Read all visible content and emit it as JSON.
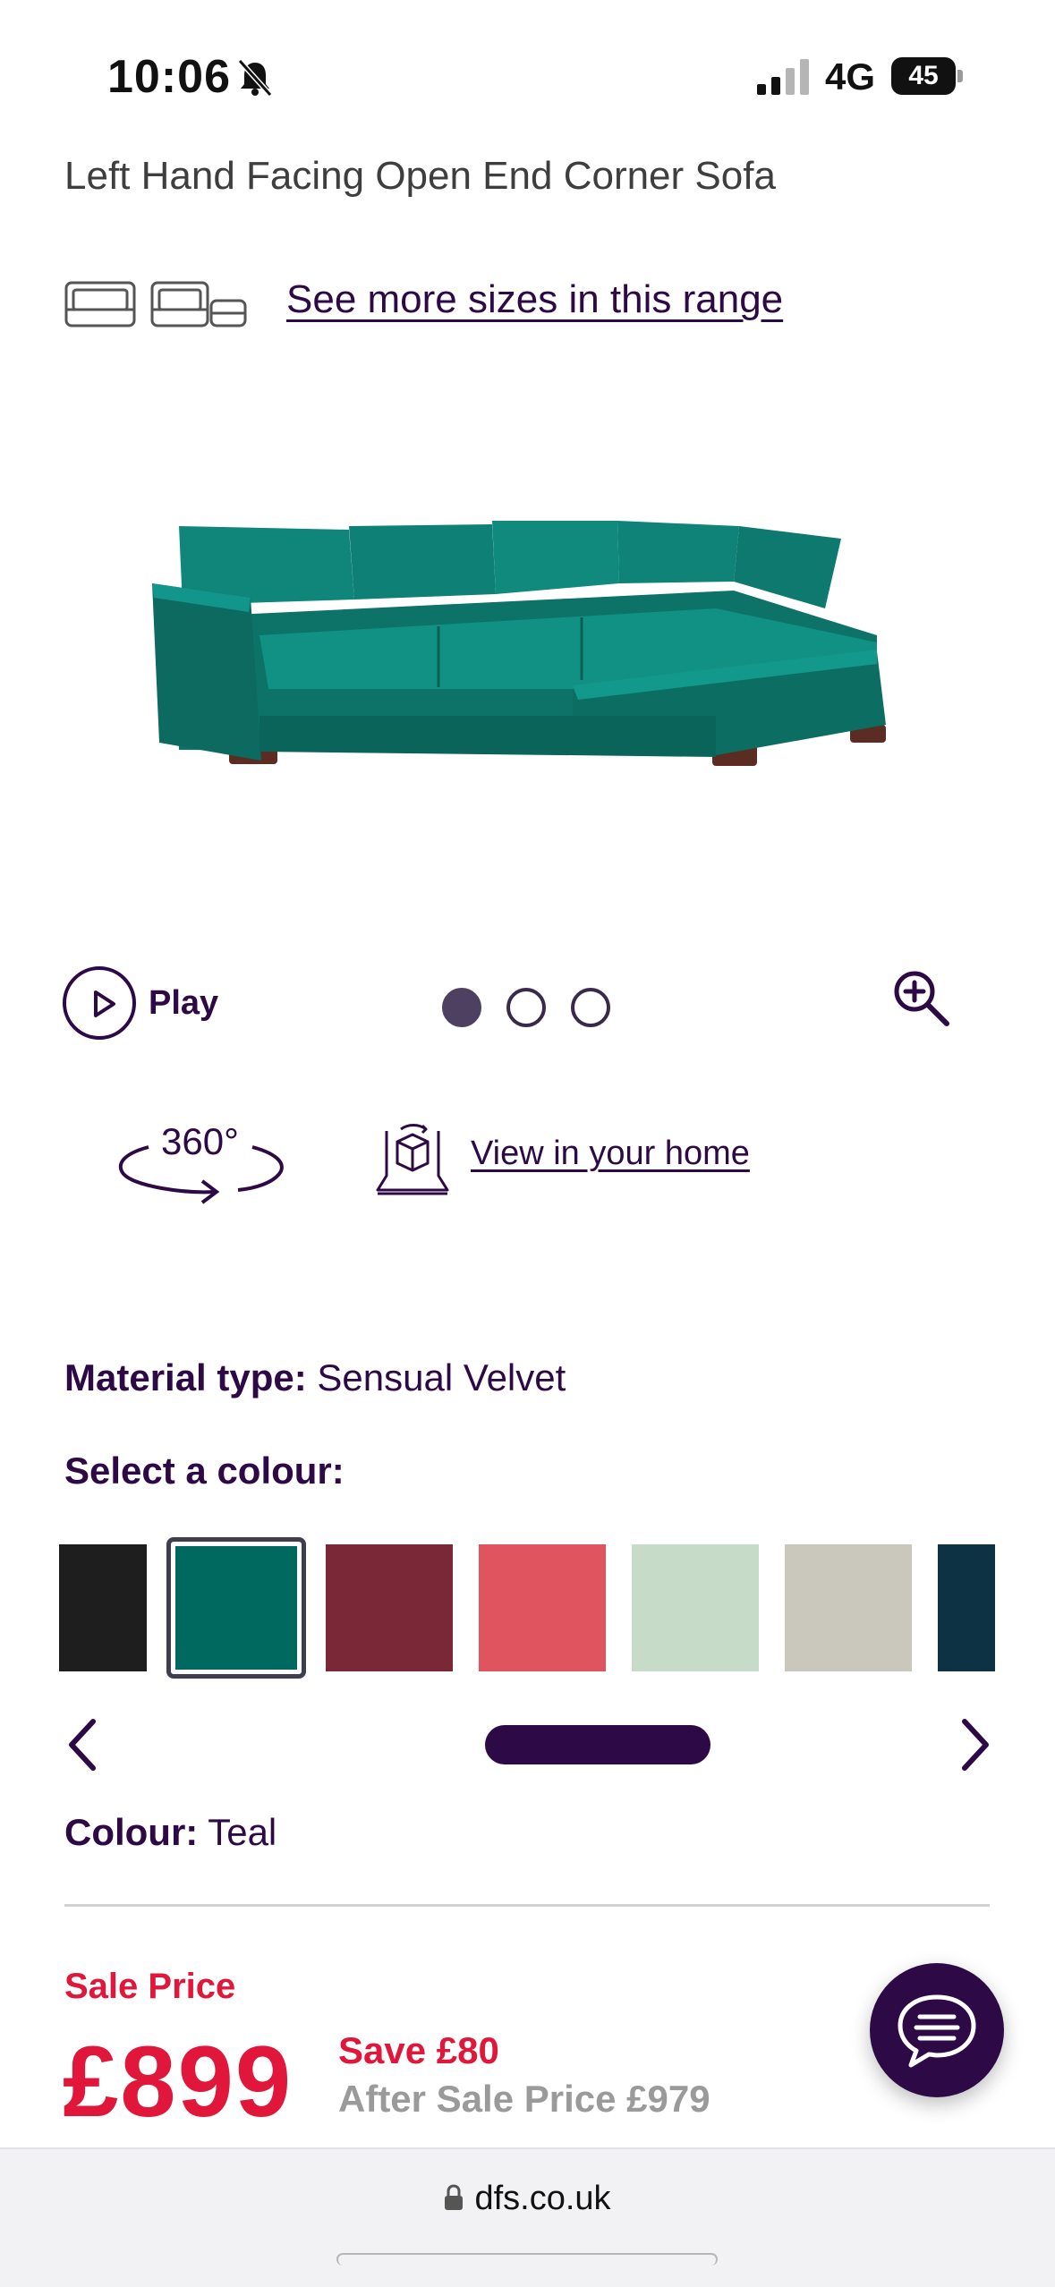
{
  "status_bar": {
    "time": "10:06",
    "network": "4G",
    "battery": "45"
  },
  "product": {
    "title": "Left Hand Facing Open End Corner Sofa",
    "sizes_link": "See more sizes in this range",
    "image_icon": "teal-corner-sofa-image"
  },
  "media_controls": {
    "play_label": "Play",
    "carousel_total": 3,
    "carousel_active": 1,
    "rotate_label": "360°",
    "ar_link": "View in your home"
  },
  "options": {
    "material_label": "Material type:",
    "material_value": "Sensual Velvet",
    "select_colour_label": "Select a colour:",
    "colour_label": "Colour:",
    "colour_value": "Teal",
    "swatches": [
      {
        "color": "#1e1e1e"
      },
      {
        "color": "#00695f",
        "selected": true
      },
      {
        "color": "#7a2737"
      },
      {
        "color": "#e05460"
      },
      {
        "color": "#c6dcc8"
      },
      {
        "color": "#cac7bc"
      },
      {
        "color": "#0c3244"
      }
    ]
  },
  "pricing": {
    "sale_label": "Sale Price",
    "price": "£899",
    "save": "Save £80",
    "after_sale": "After Sale Price £979"
  },
  "browser": {
    "url": "dfs.co.uk"
  },
  "colors": {
    "brand_purple": "#2d0a45",
    "sale_red": "#e0173a",
    "muted_grey": "#9a9a9a"
  }
}
